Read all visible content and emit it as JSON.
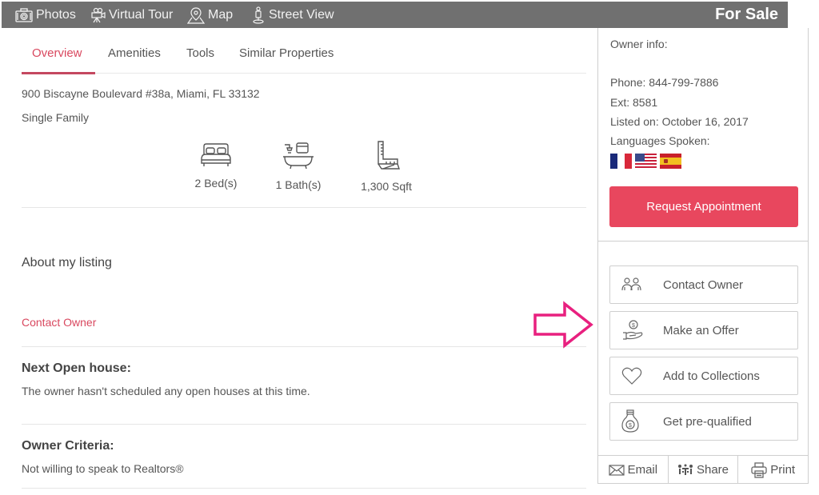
{
  "topbar": {
    "items": [
      {
        "label": "Photos",
        "icon": "camera-icon"
      },
      {
        "label": "Virtual Tour",
        "icon": "video-camera-icon"
      },
      {
        "label": "Map",
        "icon": "map-pin-icon"
      },
      {
        "label": "Street View",
        "icon": "pegman-icon"
      }
    ],
    "status": "For Sale"
  },
  "tabs": [
    {
      "label": "Overview",
      "active": true
    },
    {
      "label": "Amenities",
      "active": false
    },
    {
      "label": "Tools",
      "active": false
    },
    {
      "label": "Similar Properties",
      "active": false
    }
  ],
  "listing": {
    "address": "900 Biscayne Boulevard #38a, Miami, FL 33132",
    "property_type": "Single Family",
    "features": [
      {
        "icon": "bed-icon",
        "label": "2 Bed(s)"
      },
      {
        "icon": "bathtub-icon",
        "label": "1 Bath(s)"
      },
      {
        "icon": "ruler-icon",
        "label": "1,300 Sqft"
      }
    ]
  },
  "about": {
    "title": "About my listing",
    "contact_link": "Contact Owner"
  },
  "open_house": {
    "title": "Next Open house:",
    "text": "The owner hasn't scheduled any open houses at this time."
  },
  "criteria": {
    "title": "Owner Criteria:",
    "text": "Not willing to speak to Realtors®"
  },
  "owner": {
    "label": "Owner info:",
    "phone": "Phone: 844-799-7886",
    "ext": "Ext: 8581",
    "listed": "Listed on: October 16, 2017",
    "languages_label": "Languages Spoken:",
    "languages": [
      "French",
      "English",
      "Spanish"
    ]
  },
  "actions": {
    "request": "Request Appointment",
    "buttons": [
      {
        "label": "Contact Owner",
        "icon": "people-icon"
      },
      {
        "label": "Make an Offer",
        "icon": "hand-coin-icon"
      },
      {
        "label": "Add to Collections",
        "icon": "heart-icon"
      },
      {
        "label": "Get pre-qualified",
        "icon": "money-bag-icon"
      }
    ],
    "footer": [
      {
        "label": "Email",
        "icon": "envelope-icon"
      },
      {
        "label": "Share",
        "icon": "share-icon"
      },
      {
        "label": "Print",
        "icon": "printer-icon"
      }
    ]
  },
  "colors": {
    "accent": "#e8475e",
    "accent_text": "#d9485f",
    "topbar": "#707070",
    "annotation_arrow": "#e8207f"
  }
}
